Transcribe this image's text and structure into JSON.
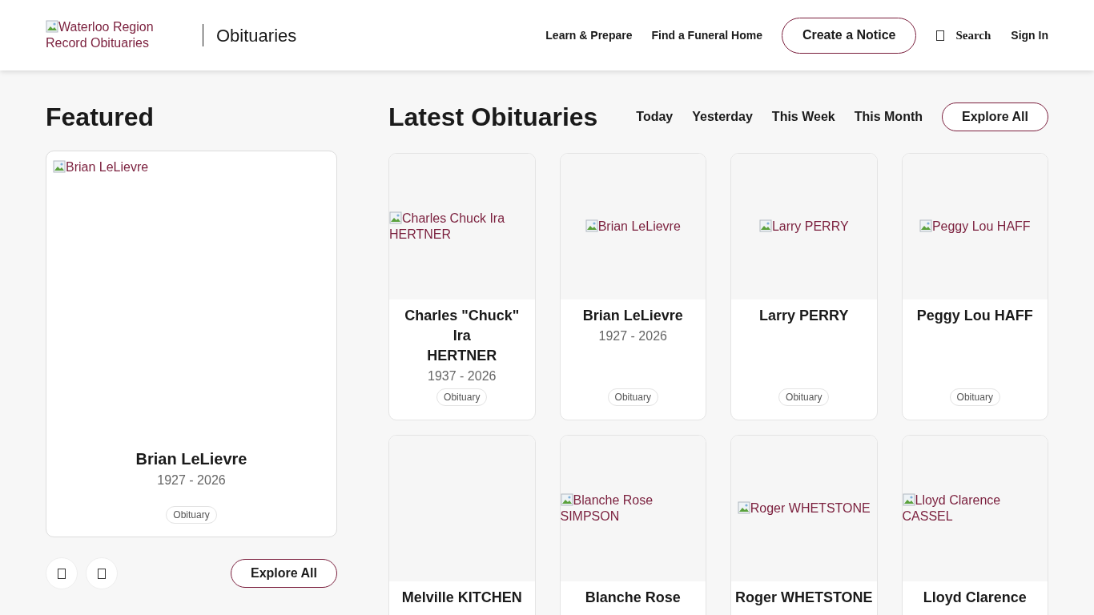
{
  "header": {
    "logo_alt": "Waterloo Region Record Obituaries",
    "section": "Obituaries",
    "nav": [
      "Learn & Prepare",
      "Find a Funeral Home"
    ],
    "cta": "Create a Notice",
    "search": "Search",
    "sign_in": "Sign In"
  },
  "featured": {
    "title": "Featured",
    "image_alt": "Brian LeLievre",
    "name": "Brian LeLievre",
    "dates": "1927 - 2026",
    "tag": "Obituary",
    "explore": "Explore All"
  },
  "latest": {
    "title": "Latest Obituaries",
    "filters": [
      "Today",
      "Yesterday",
      "This Week",
      "This Month"
    ],
    "explore": "Explore All",
    "cards": [
      {
        "image_alt": "Charles Chuck Ira HERTNER",
        "name_lines": [
          "Charles \"Chuck\"",
          "Ira",
          "HERTNER"
        ],
        "dates": "1937 - 2026",
        "tag": "Obituary"
      },
      {
        "image_alt": "Brian LeLievre",
        "name_lines": [
          "Brian LeLievre"
        ],
        "dates": "1927 - 2026",
        "tag": "Obituary"
      },
      {
        "image_alt": "Larry PERRY",
        "name_lines": [
          "Larry PERRY"
        ],
        "tag": "Obituary"
      },
      {
        "image_alt": "Peggy Lou HAFF",
        "name_lines": [
          "Peggy Lou HAFF"
        ],
        "tag": "Obituary"
      },
      {
        "name_lines": [
          "Melville KITCHEN"
        ]
      },
      {
        "image_alt": "Blanche Rose SIMPSON",
        "name_lines": [
          "Blanche Rose"
        ]
      },
      {
        "image_alt": "Roger WHETSTONE",
        "name_lines": [
          "Roger WHETSTONE"
        ]
      },
      {
        "image_alt": "Lloyd Clarence CASSEL",
        "name_lines": [
          "Lloyd Clarence"
        ]
      }
    ]
  }
}
